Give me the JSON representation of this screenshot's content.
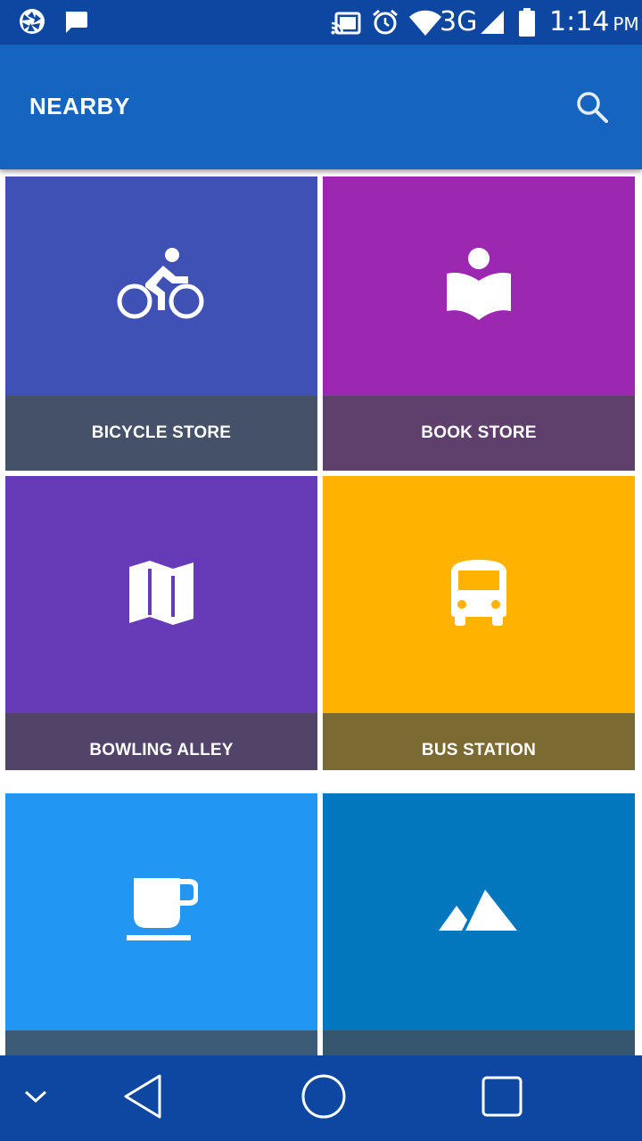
{
  "status_bar": {
    "time": "1:14",
    "ampm": "PM",
    "network": "3G",
    "icons": [
      "aperture-icon",
      "message-icon",
      "cast-icon",
      "alarm-icon",
      "wifi-icon",
      "signal-icon",
      "battery-icon"
    ]
  },
  "app_bar": {
    "title": "NEARBY",
    "search_icon": "search-icon"
  },
  "tiles": [
    {
      "label": "BICYCLE STORE",
      "icon": "bicycle-icon",
      "top_color": "#3f51b5",
      "bottom_color": "#455069"
    },
    {
      "label": "BOOK STORE",
      "icon": "book-reader-icon",
      "top_color": "#9c27b0",
      "bottom_color": "#5f3f6b"
    },
    {
      "label": "BOWLING ALLEY",
      "icon": "map-icon",
      "top_color": "#673ab7",
      "bottom_color": "#514468"
    },
    {
      "label": "BUS STATION",
      "icon": "bus-icon",
      "top_color": "#ffb300",
      "bottom_color": "#7c6a33"
    },
    {
      "label": "",
      "icon": "cafe-cup-icon",
      "top_color": "#2196f3",
      "bottom_color": "#3c5b77"
    },
    {
      "label": "",
      "icon": "mountains-icon",
      "top_color": "#0277bd",
      "bottom_color": "#35566e"
    }
  ],
  "nav_bar": {
    "icons": [
      "chevron-down-icon",
      "back-icon",
      "home-icon",
      "recents-icon"
    ]
  }
}
